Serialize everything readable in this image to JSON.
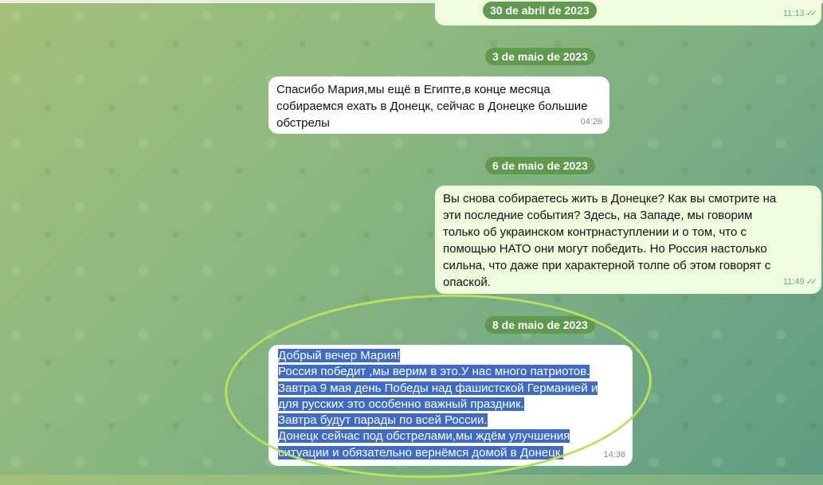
{
  "dates": {
    "d1": "30 de abril de 2023",
    "d2": "3 de maio de 2023",
    "d3": "6 de maio de 2023",
    "d4": "8 de maio de 2023"
  },
  "messages": {
    "m0": {
      "time": "11:13",
      "read": "✓✓"
    },
    "m1": {
      "lines": [
        "Спасибо Мария,мы ещё в Египте,в конце месяца",
        "собираемся ехать в Донецк, сейчас в Донецке большие",
        "обстрелы"
      ],
      "time": "04:26"
    },
    "m2": {
      "lines": [
        "Вы снова собираетесь жить в Донецке? Как вы смотрите на",
        "эти последние события? Здесь, на Западе, мы говорим",
        "только об украинском контрнаступлении и о том, что с",
        "помощью НАТО они могут победить. Но Россия настолько",
        "сильна, что даже при характерной толпе об этом говорят с",
        "опаской."
      ],
      "time": "11:49",
      "read": "✓✓"
    },
    "m3": {
      "lines": [
        "Добрый вечер Мария!",
        "Россия победит ,мы верим в это.У нас много патриотов.",
        "Завтра 9 мая день Победы над фашистской Германией и",
        "для русских это особенно важный праздник.",
        "Завтра будут парады по всей России.",
        "Донецк сейчас под обстрелами,мы ждём улучшения",
        "ситуации и обязательно вернёмся домой в Донецк."
      ],
      "time": "14:36"
    }
  }
}
